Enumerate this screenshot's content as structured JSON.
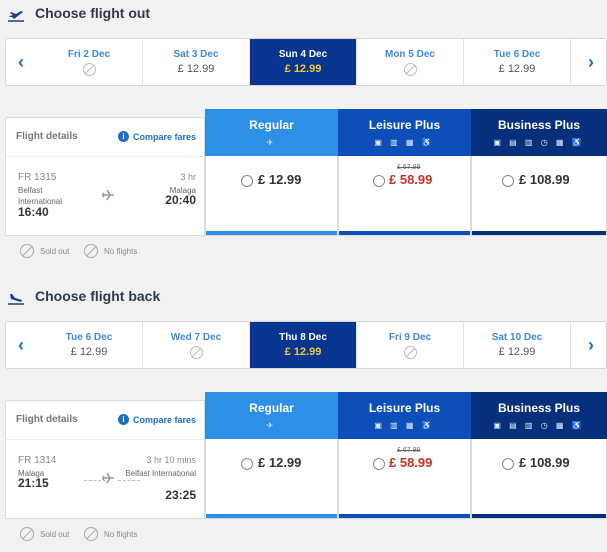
{
  "outbound": {
    "title": "Choose flight out",
    "dates": [
      {
        "label": "Fri 2 Dec",
        "price": "",
        "available": false,
        "selected": false
      },
      {
        "label": "Sat 3 Dec",
        "price": "£ 12.99",
        "available": true,
        "selected": false
      },
      {
        "label": "Sun 4 Dec",
        "price": "£ 12.99",
        "available": true,
        "selected": true
      },
      {
        "label": "Mon 5 Dec",
        "price": "",
        "available": false,
        "selected": false
      },
      {
        "label": "Tue 6 Dec",
        "price": "£ 12.99",
        "available": true,
        "selected": false
      }
    ],
    "flight": {
      "number": "FR 1315",
      "from_city": "Belfast International",
      "departure": "16:40",
      "duration": "3 hr",
      "to_city": "Malaga",
      "arrival": "20:40"
    }
  },
  "inbound": {
    "title": "Choose flight back",
    "dates": [
      {
        "label": "Tue 6 Dec",
        "price": "£ 12.99",
        "available": true,
        "selected": false
      },
      {
        "label": "Wed 7 Dec",
        "price": "",
        "available": false,
        "selected": false
      },
      {
        "label": "Thu 8 Dec",
        "price": "£ 12.99",
        "available": true,
        "selected": true
      },
      {
        "label": "Fri 9 Dec",
        "price": "",
        "available": false,
        "selected": false
      },
      {
        "label": "Sat 10 Dec",
        "price": "£ 12.99",
        "available": true,
        "selected": false
      }
    ],
    "flight": {
      "number": "FR 1314",
      "from_city": "Malaga",
      "departure": "21:15",
      "duration": "3 hr 10 mins",
      "to_city": "Belfast International",
      "arrival": "23:25"
    }
  },
  "details": {
    "title": "Flight details",
    "compare_label": "Compare fares",
    "info_icon": "i"
  },
  "fares": {
    "regular": {
      "name": "Regular",
      "price": "£ 12.99",
      "icons": "✈"
    },
    "leisure": {
      "name": "Leisure Plus",
      "old_price": "£ 67.99",
      "price": "£ 58.99",
      "icons": "▣ ▥ ▦ ♿"
    },
    "business": {
      "name": "Business Plus",
      "price": "£ 108.99",
      "icons": "▣ ▤ ▥ ◷ ▦ ♿"
    }
  },
  "legend": {
    "sold_out": "Sold out",
    "no_flights": "No flights"
  },
  "colors": {
    "regular": "#2d8fe6",
    "leisure": "#0d4fb8",
    "business": "#062f7c",
    "selected_date": "#073590",
    "selected_price": "#f1c933",
    "sale_price": "#c8312a"
  }
}
